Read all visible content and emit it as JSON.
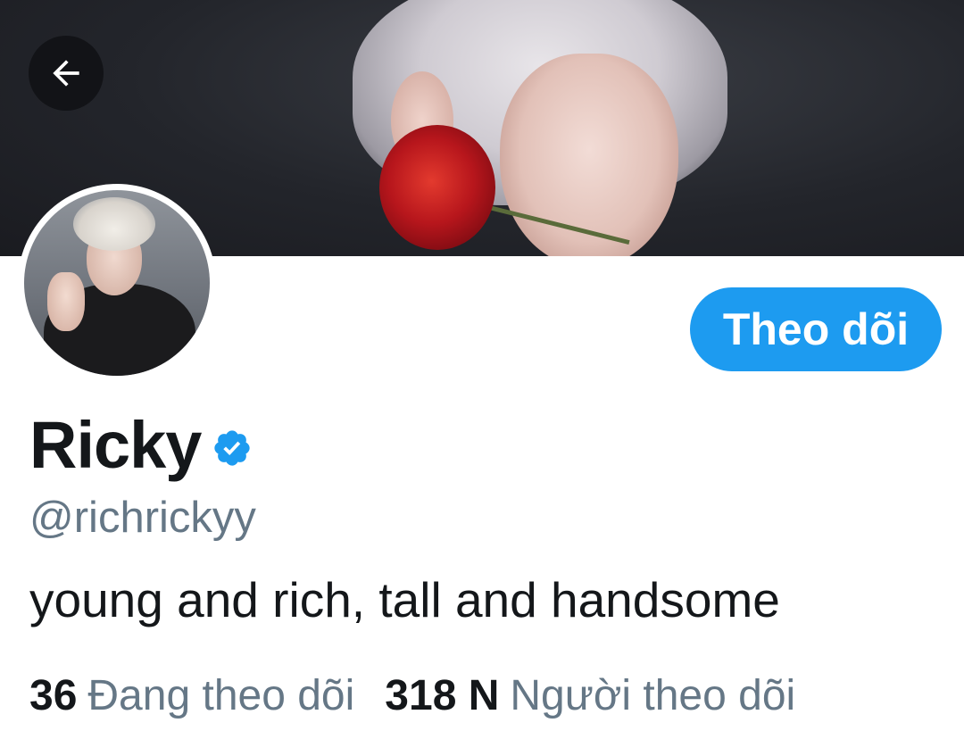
{
  "header": {
    "back_icon": "arrow-left-icon"
  },
  "profile": {
    "display_name": "Ricky",
    "verified_icon": "verified-badge-icon",
    "handle": "@richrickyy",
    "bio": "young and rich, tall and handsome",
    "follow_label": "Theo dõi"
  },
  "stats": {
    "following_count": "36",
    "following_label": "Đang theo dõi",
    "followers_count": "318 N",
    "followers_label": "Người theo dõi"
  },
  "colors": {
    "accent": "#1d9bf0",
    "text_primary": "#14171a",
    "text_secondary": "#657786"
  }
}
